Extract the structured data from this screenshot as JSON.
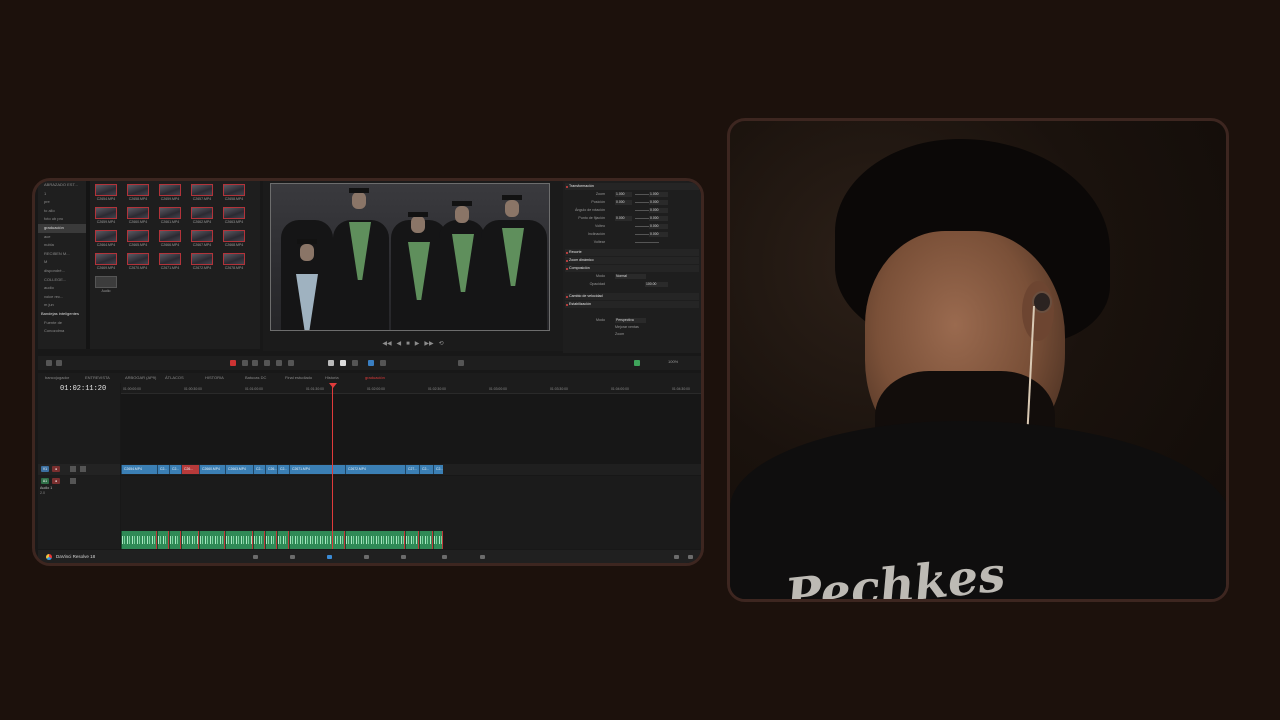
{
  "editor": {
    "media_tree": [
      {
        "label": "ABRAZADO EST...",
        "selected": false,
        "header": false
      },
      {
        "label": "1",
        "selected": false,
        "header": false
      },
      {
        "label": "pre",
        "selected": false,
        "header": false
      },
      {
        "label": "to allo",
        "selected": false,
        "header": false
      },
      {
        "label": "foto ub pro",
        "selected": false,
        "header": false
      },
      {
        "label": "graduación",
        "selected": true,
        "header": false
      },
      {
        "label": "ace",
        "selected": false,
        "header": false
      },
      {
        "label": "nubla",
        "selected": false,
        "header": false
      },
      {
        "label": "RECIBEN M...",
        "selected": false,
        "header": false
      },
      {
        "label": "M",
        "selected": false,
        "header": false
      },
      {
        "label": "dispondré...",
        "selected": false,
        "header": false
      },
      {
        "label": "COLLEGE...",
        "selected": false,
        "header": false
      },
      {
        "label": "audio",
        "selected": false,
        "header": false
      },
      {
        "label": "voice rec...",
        "selected": false,
        "header": false
      },
      {
        "label": "m jun",
        "selected": false,
        "header": false
      },
      {
        "label": "Bandejas inteligentes",
        "selected": false,
        "header": true
      },
      {
        "label": "Fuente de",
        "selected": false,
        "header": false
      },
      {
        "label": "Conozolma",
        "selected": false,
        "header": false
      }
    ],
    "media_pool": [
      "C2654.MP4",
      "C2658.MP4",
      "C2659.MP4",
      "C2657.MP4",
      "C2658.MP4",
      "C2659.MP4",
      "C2660.MP4",
      "C2661.MP4",
      "C2662.MP4",
      "C2663.MP4",
      "C2664.MP4",
      "C2665.MP4",
      "C2666.MP4",
      "C2667.MP4",
      "C2668.MP4",
      "C2669.MP4",
      "C2670.MP4",
      "C2671.MP4",
      "C2672.MP4",
      "C2678.MP4",
      "Audio"
    ],
    "inspector": {
      "sections": [
        {
          "title": "Transformación"
        },
        {
          "title": "Recorte"
        },
        {
          "title": "Zoom dinámico"
        },
        {
          "title": "Composición"
        },
        {
          "title": "Cambio de velocidad"
        },
        {
          "title": "Estabilización"
        }
      ],
      "rows": [
        {
          "label": "Zoom",
          "x": "1.000",
          "y": "1.000"
        },
        {
          "label": "Posición",
          "x": "0.000",
          "y": "0.000"
        },
        {
          "label": "Ángulo de rotación",
          "x": "",
          "y": "0.000"
        },
        {
          "label": "Punto de fijación",
          "x": "0.000",
          "y": "0.000"
        },
        {
          "label": "Volteo",
          "x": "",
          "y": "0.000"
        },
        {
          "label": "Inclinación",
          "x": "",
          "y": "0.000"
        },
        {
          "label": "Voltear",
          "x": "",
          "y": ""
        }
      ],
      "composite_mode_label": "Modo",
      "composite_mode": "Normal",
      "opacity_label": "Opacidad",
      "opacity": "100.00",
      "stab_mode_label": "Modo",
      "stab_mode": "Perspectiva",
      "stab_option1": "Mejorar ventas",
      "stab_option2": "Zoom"
    },
    "toolbar_value": "100%",
    "tabs": [
      {
        "label": "bancojugador",
        "active": false
      },
      {
        "label": "ENTREVISTA",
        "active": false
      },
      {
        "label": "ARBOGAR (AP9)",
        "active": false
      },
      {
        "label": "ÁTLACOS",
        "active": false
      },
      {
        "label": "HISTORIA",
        "active": false
      },
      {
        "label": "Batucas DC",
        "active": false
      },
      {
        "label": "Final estudiado",
        "active": false
      },
      {
        "label": "Historia",
        "active": false
      },
      {
        "label": "graduación",
        "active": true
      }
    ],
    "timecode": "01:02:11:20",
    "ruler_ticks": [
      "01:00:00:00",
      "01:00:30:00",
      "01:01:00:00",
      "01:01:30:00",
      "01:02:00:00",
      "01:02:30:00",
      "01:03:00:00",
      "01:03:30:00",
      "01:04:00:00",
      "01:04:30:00"
    ],
    "video_track": {
      "badge": "V1",
      "name": "Video 1"
    },
    "audio_track": {
      "badge": "A1",
      "name": "Audio 1",
      "level": "2.0"
    },
    "video_clips": [
      "C2654.MP4",
      "C2...",
      "C2...",
      "C26...",
      "C2660.MP4",
      "C2663.MP4",
      "C2...",
      "C26...",
      "C2...",
      "C2671.MP4",
      "C2672.MP4",
      "C27...",
      "C2...",
      "C2..."
    ],
    "status_app_name": "DaVinci Resolve 18"
  },
  "webcam": {
    "shirt_text": "Pechkes"
  },
  "colors": {
    "page_bg": "#1c110c",
    "frame_border": "#3d2620",
    "clip_blue": "#3b7fb4",
    "clip_green": "#2f8a56",
    "playhead_red": "#e03b3b"
  }
}
